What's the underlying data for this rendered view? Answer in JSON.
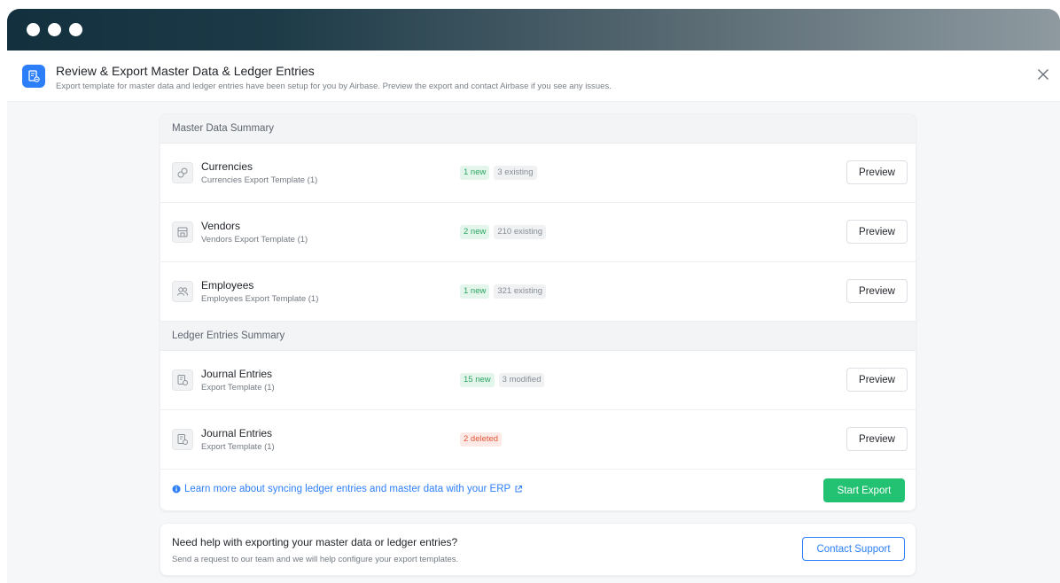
{
  "header": {
    "title": "Review & Export Master Data & Ledger Entries",
    "subtitle": "Export template for master data and ledger entries have been setup for you by Airbase. Preview the export and contact Airbase if you see any issues.",
    "icon": "document-export-icon"
  },
  "master": {
    "heading": "Master Data Summary",
    "rows": [
      {
        "title": "Currencies",
        "sub": "Currencies Export Template (1)",
        "badge1": "1 new",
        "badge2": "3 existing",
        "icon": "currency-coins-icon",
        "action": "Preview"
      },
      {
        "title": "Vendors",
        "sub": "Vendors Export Template (1)",
        "badge1": "2 new",
        "badge2": "210 existing",
        "icon": "storefront-icon",
        "action": "Preview"
      },
      {
        "title": "Employees",
        "sub": "Employees Export Template (1)",
        "badge1": "1 new",
        "badge2": "321 existing",
        "icon": "users-icon",
        "action": "Preview"
      }
    ]
  },
  "ledger": {
    "heading": "Ledger Entries Summary",
    "rows": [
      {
        "title": "Journal Entries",
        "sub": "Export Template (1)",
        "badge1": "15 new",
        "badge2": "3 modified",
        "icon": "journal-document-icon",
        "action": "Preview"
      },
      {
        "title": "Journal Entries",
        "sub": "Export Template (1)",
        "badge1": "2 deleted",
        "icon": "journal-document-icon",
        "action": "Preview"
      }
    ]
  },
  "footer": {
    "learn_more": "Learn more about syncing ledger entries and master data with your ERP",
    "start_export": "Start Export"
  },
  "help": {
    "title": "Need help with exporting your master data or ledger entries?",
    "subtitle": "Send a request to our team and we will help configure your export templates.",
    "button": "Contact Support"
  },
  "colors": {
    "accent": "#2d7ff9",
    "success": "#23c272",
    "danger": "#e2563b"
  }
}
